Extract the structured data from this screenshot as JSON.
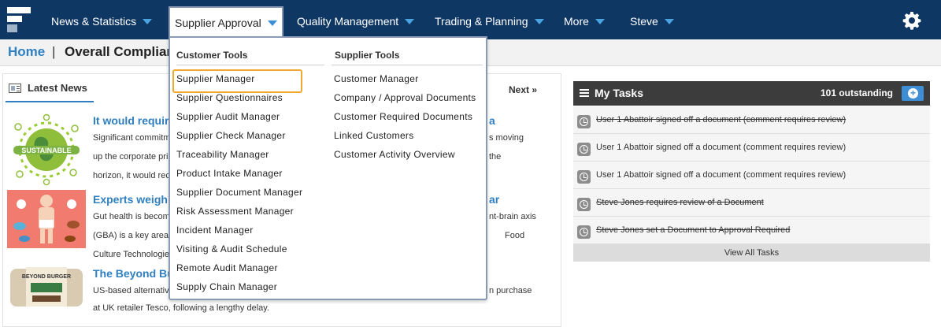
{
  "nav": {
    "items": [
      {
        "label": "News & Statistics"
      },
      {
        "label": "Supplier Approval"
      },
      {
        "label": "Quality Management"
      },
      {
        "label": "Trading & Planning"
      },
      {
        "label": "More"
      },
      {
        "label": "Steve"
      }
    ],
    "active_index": 1,
    "settings_icon": "gear-icon"
  },
  "breadcrumb": {
    "home": "Home",
    "separator": "|",
    "current": "Overall Compliance"
  },
  "news": {
    "tab_label": "Latest News",
    "next_label": "Next »",
    "articles": [
      {
        "title": "It would require",
        "title_tail": "a",
        "lines": [
          "Significant commitm",
          "up the corporate pri",
          "horizon, it would rec"
        ],
        "right_lines": [
          "s moving",
          "the",
          ""
        ],
        "thumb_text": "SUSTAINABLE"
      },
      {
        "title": "Experts weigh i",
        "title_tail": "ar",
        "lines": [
          "Gut health is becom",
          "(GBA) is a key area",
          "Culture Technologie"
        ],
        "right_lines": [
          "nt-brain axis",
          "Food",
          ""
        ]
      },
      {
        "title": "The Beyond Bu",
        "title_tail": "",
        "lines": [
          "US-based alternativ",
          "at UK retailer Tesco, following a lengthy delay."
        ],
        "right_lines": [
          "n purchase",
          ""
        ],
        "thumb_text": "BEYOND BURGER"
      }
    ]
  },
  "tasks": {
    "title": "My Tasks",
    "count": "101 outstanding",
    "items": [
      {
        "text": "User 1 Abattoir signed off a document (comment requires review)",
        "done": true
      },
      {
        "text": "User 1 Abattoir signed off a document (comment requires review)",
        "done": false
      },
      {
        "text": "User 1 Abattoir signed off a document (comment requires review)",
        "done": false
      },
      {
        "text": "Steve Jones requires review of a Document",
        "done": true
      },
      {
        "text": "Steve Jones set a Document to Approval Required",
        "done": true
      }
    ],
    "view_all": "View All Tasks"
  },
  "dropdown": {
    "customer_tools": {
      "heading": "Customer Tools",
      "items": [
        "Supplier Manager",
        "Supplier Questionnaires",
        "Supplier Audit Manager",
        "Supplier Check Manager",
        "Traceability Manager",
        "Product Intake Manager",
        "Supplier Document Manager",
        "Risk Assessment Manager",
        "Incident Manager",
        "Visiting & Audit Schedule",
        "Remote Audit Manager",
        "Supply Chain Manager"
      ],
      "highlighted_index": 0
    },
    "supplier_tools": {
      "heading": "Supplier Tools",
      "items": [
        "Customer Manager",
        "Company / Approval Documents",
        "Customer Required Documents",
        "Linked Customers",
        "Customer Activity Overview"
      ]
    }
  },
  "colors": {
    "nav_bg": "#0f3764",
    "link_blue": "#2f7fc1",
    "caret_blue": "#4aa3df",
    "highlight_orange": "#f0a830",
    "tasks_header": "#3c3c3c"
  }
}
